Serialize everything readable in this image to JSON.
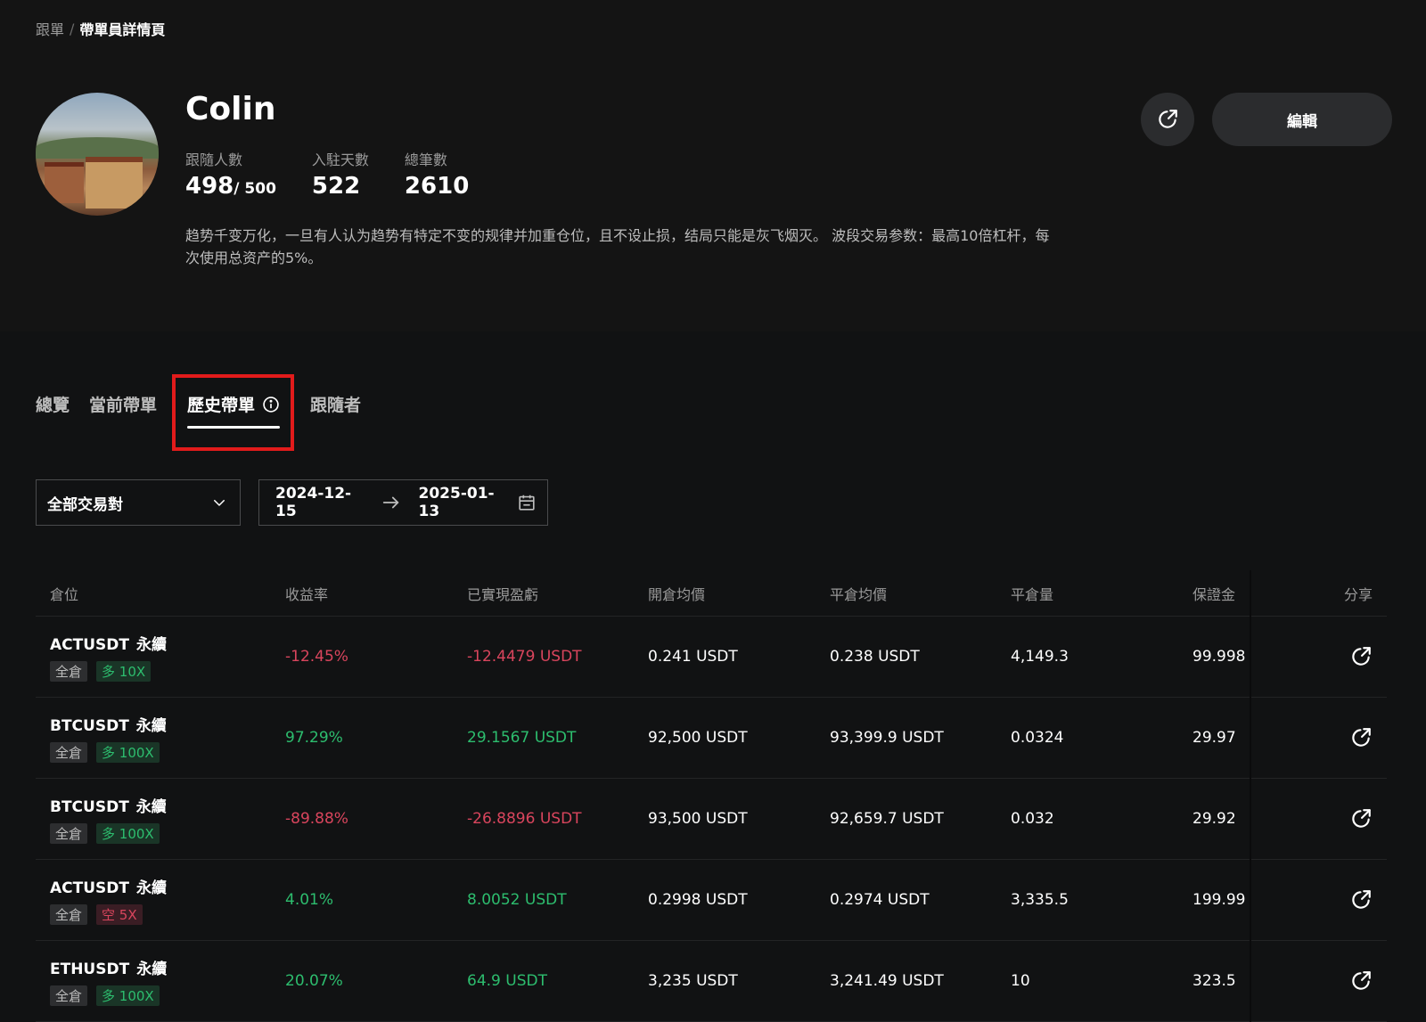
{
  "breadcrumb": {
    "parent": "跟單",
    "separator": "/",
    "current": "帶單員詳情頁"
  },
  "profile": {
    "name": "Colin",
    "stats": [
      {
        "label": "跟隨人數",
        "value": "498",
        "sub": "/ 500"
      },
      {
        "label": "入駐天數",
        "value": "522",
        "sub": ""
      },
      {
        "label": "總筆數",
        "value": "2610",
        "sub": ""
      }
    ],
    "bio": "趋势千变万化，一旦有人认为趋势有特定不变的规律并加重仓位，且不设止损，结局只能是灰飞烟灭。 波段交易参数：最高10倍杠杆，每次使用总资产的5%。",
    "edit_label": "編輯"
  },
  "tabs": [
    {
      "label": "總覽"
    },
    {
      "label": "當前帶單"
    },
    {
      "label": "歷史帶單"
    },
    {
      "label": "跟隨者"
    }
  ],
  "filters": {
    "pair_select": "全部交易對",
    "date_start": "2024-12-15",
    "date_end": "2025-01-13"
  },
  "table": {
    "headers": [
      "倉位",
      "收益率",
      "已實現盈虧",
      "開倉均價",
      "平倉均價",
      "平倉量",
      "保證金",
      "分享"
    ],
    "rows": [
      {
        "symbol": "ACTUSDT",
        "contract": "永續",
        "margin_mode": "全倉",
        "side_lev": "多 10X",
        "side": "long",
        "roi": "-12.45%",
        "pnl": "-12.4479 USDT",
        "pnl_sign": "neg",
        "open": "0.241 USDT",
        "close": "0.238 USDT",
        "qty": "4,149.3",
        "margin": "99.998"
      },
      {
        "symbol": "BTCUSDT",
        "contract": "永續",
        "margin_mode": "全倉",
        "side_lev": "多 100X",
        "side": "long",
        "roi": "97.29%",
        "pnl": "29.1567 USDT",
        "pnl_sign": "pos",
        "open": "92,500 USDT",
        "close": "93,399.9 USDT",
        "qty": "0.0324",
        "margin": "29.97"
      },
      {
        "symbol": "BTCUSDT",
        "contract": "永續",
        "margin_mode": "全倉",
        "side_lev": "多 100X",
        "side": "long",
        "roi": "-89.88%",
        "pnl": "-26.8896 USDT",
        "pnl_sign": "neg",
        "open": "93,500 USDT",
        "close": "92,659.7 USDT",
        "qty": "0.032",
        "margin": "29.92"
      },
      {
        "symbol": "ACTUSDT",
        "contract": "永續",
        "margin_mode": "全倉",
        "side_lev": "空 5X",
        "side": "short",
        "roi": "4.01%",
        "pnl": "8.0052 USDT",
        "pnl_sign": "pos",
        "open": "0.2998 USDT",
        "close": "0.2974 USDT",
        "qty": "3,335.5",
        "margin": "199.99"
      },
      {
        "symbol": "ETHUSDT",
        "contract": "永續",
        "margin_mode": "全倉",
        "side_lev": "多 100X",
        "side": "long",
        "roi": "20.07%",
        "pnl": "64.9 USDT",
        "pnl_sign": "pos",
        "open": "3,235 USDT",
        "close": "3,241.49 USDT",
        "qty": "10",
        "margin": "323.5"
      }
    ]
  },
  "colors": {
    "accent_negative": "#d9455d",
    "accent_positive": "#2dbd6e",
    "highlight": "#e21b1b"
  },
  "icons": {
    "share": "share-icon",
    "info": "info-icon",
    "dropdown": "chevron-down-icon",
    "calendar": "calendar-icon",
    "arrow": "arrow-right-icon"
  }
}
